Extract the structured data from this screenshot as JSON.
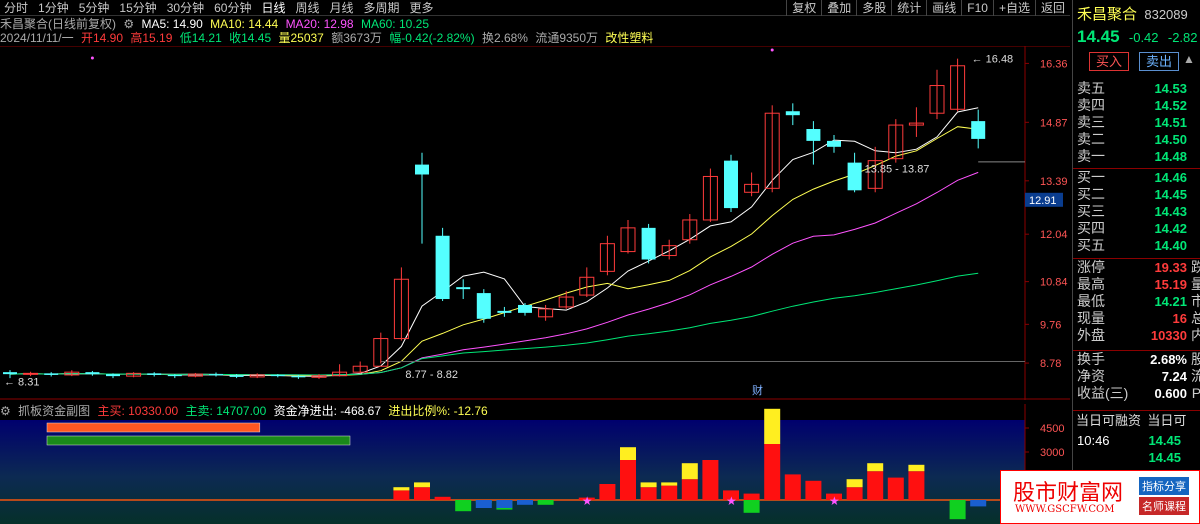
{
  "toolbar": {
    "periods": [
      "分时",
      "1分钟",
      "5分钟",
      "15分钟",
      "30分钟",
      "60分钟",
      "日线",
      "周线",
      "月线",
      "多周期",
      "更多"
    ],
    "active_period": "日线",
    "actions": [
      "复权",
      "叠加",
      "多股",
      "统计",
      "画线",
      "F10",
      "+自选",
      "返回"
    ]
  },
  "info1": {
    "title": "禾昌聚合(日线前复权)",
    "ma5": "MA5: 14.90",
    "ma10": "MA10: 14.44",
    "ma20": "MA20: 12.98",
    "ma60": "MA60: 10.25"
  },
  "info2": {
    "date": "2024/11/11/一",
    "open": "开14.90",
    "high": "高15.19",
    "low": "低14.21",
    "close": "收14.45",
    "vol": "量25037",
    "amount": "额3673万",
    "change": "幅-0.42(-2.82%)",
    "turnover": "换2.68%",
    "float": "流通9350万",
    "concept": "改性塑料"
  },
  "price_axis": [
    "16.36",
    "14.87",
    "13.39",
    "12.04",
    "10.84",
    "9.76",
    "8.78"
  ],
  "price_tag": "12.91",
  "annotations": {
    "high_label": "16.48",
    "range_label": "13.85 - 13.87",
    "low_label": "8.31",
    "low_range": "8.77 - 8.82",
    "cai": "财"
  },
  "sub_header": {
    "title": "抓板资金副图",
    "main_buy": "主买: 10330.00",
    "main_sell": "主卖: 14707.00",
    "net": "资金净进出: -468.67",
    "ratio": "进出比例%: -12.76"
  },
  "sub_axis": [
    "4500",
    "3000",
    "1500"
  ],
  "right_panel": {
    "name": "禾昌聚合",
    "code": "832089",
    "price": "14.45",
    "change": "-0.42",
    "pct": "-2.82",
    "buy_btn": "买入",
    "sell_btn": "卖出",
    "asks": [
      {
        "label": "卖五",
        "price": "14.53"
      },
      {
        "label": "卖四",
        "price": "14.52"
      },
      {
        "label": "卖三",
        "price": "14.51"
      },
      {
        "label": "卖二",
        "price": "14.50"
      },
      {
        "label": "卖一",
        "price": "14.48"
      }
    ],
    "bids": [
      {
        "label": "买一",
        "price": "14.46"
      },
      {
        "label": "买二",
        "price": "14.45"
      },
      {
        "label": "买三",
        "price": "14.43"
      },
      {
        "label": "买四",
        "price": "14.42"
      },
      {
        "label": "买五",
        "price": "14.40"
      }
    ],
    "stats": [
      {
        "label": "涨停",
        "value": "19.33",
        "extra": "跌"
      },
      {
        "label": "最高",
        "value": "15.19",
        "extra": "量"
      },
      {
        "label": "最低",
        "value": "14.21",
        "extra": "市"
      },
      {
        "label": "现量",
        "value": "16",
        "extra": "总"
      },
      {
        "label": "外盘",
        "value": "10330",
        "extra": "内"
      }
    ],
    "stats2": [
      {
        "label": "换手",
        "value": "2.68%",
        "extra": "股"
      },
      {
        "label": "净资",
        "value": "7.24",
        "extra": "流"
      },
      {
        "label": "收益(三)",
        "value": "0.600",
        "extra": "PI"
      }
    ],
    "margin_label": "当日可融资",
    "margin_label2": "当日可",
    "ticks": [
      {
        "time": "10:46",
        "price": "14.45"
      },
      {
        "time": "",
        "price": "14.45"
      }
    ]
  },
  "watermark": {
    "title": "股市财富网",
    "url": "WWW.GSCFW.COM",
    "tag1": "指标分享",
    "tag2": "名师课程"
  },
  "colors": {
    "up": "#ff3b3b",
    "down": "#54ffff",
    "ma5": "#ffffff",
    "ma10": "#ffff54",
    "ma20": "#ff54ff",
    "ma60": "#00e676"
  },
  "chart_data": {
    "type": "candlestick",
    "note_ma": "MA5 white, MA10 yellow, MA20 magenta, MA60 green",
    "candles": [
      {
        "o": 8.55,
        "c": 8.5,
        "h": 8.6,
        "l": 8.4
      },
      {
        "o": 8.5,
        "c": 8.52,
        "h": 8.56,
        "l": 8.45
      },
      {
        "o": 8.52,
        "c": 8.48,
        "h": 8.55,
        "l": 8.44
      },
      {
        "o": 8.48,
        "c": 8.55,
        "h": 8.6,
        "l": 8.45
      },
      {
        "o": 8.55,
        "c": 8.5,
        "h": 8.58,
        "l": 8.46
      },
      {
        "o": 8.5,
        "c": 8.45,
        "h": 8.52,
        "l": 8.4
      },
      {
        "o": 8.45,
        "c": 8.52,
        "h": 8.55,
        "l": 8.42
      },
      {
        "o": 8.52,
        "c": 8.48,
        "h": 8.55,
        "l": 8.44
      },
      {
        "o": 8.48,
        "c": 8.45,
        "h": 8.5,
        "l": 8.4
      },
      {
        "o": 8.45,
        "c": 8.5,
        "h": 8.53,
        "l": 8.42
      },
      {
        "o": 8.5,
        "c": 8.47,
        "h": 8.54,
        "l": 8.44
      },
      {
        "o": 8.47,
        "c": 8.43,
        "h": 8.5,
        "l": 8.4
      },
      {
        "o": 8.43,
        "c": 8.48,
        "h": 8.52,
        "l": 8.4
      },
      {
        "o": 8.48,
        "c": 8.45,
        "h": 8.5,
        "l": 8.42
      },
      {
        "o": 8.45,
        "c": 8.42,
        "h": 8.48,
        "l": 8.38
      },
      {
        "o": 8.42,
        "c": 8.46,
        "h": 8.5,
        "l": 8.38
      },
      {
        "o": 8.46,
        "c": 8.55,
        "h": 8.75,
        "l": 8.44
      },
      {
        "o": 8.55,
        "c": 8.7,
        "h": 8.82,
        "l": 8.52
      },
      {
        "o": 8.7,
        "c": 9.4,
        "h": 9.55,
        "l": 8.77
      },
      {
        "o": 9.4,
        "c": 10.9,
        "h": 11.2,
        "l": 9.35
      },
      {
        "o": 13.8,
        "c": 13.55,
        "h": 14.1,
        "l": 11.8
      },
      {
        "o": 12.0,
        "c": 10.4,
        "h": 12.2,
        "l": 10.35
      },
      {
        "o": 10.7,
        "c": 10.65,
        "h": 10.9,
        "l": 10.4
      },
      {
        "o": 10.55,
        "c": 9.9,
        "h": 10.65,
        "l": 9.8
      },
      {
        "o": 10.1,
        "c": 10.05,
        "h": 10.2,
        "l": 9.95
      },
      {
        "o": 10.25,
        "c": 10.05,
        "h": 10.3,
        "l": 9.98
      },
      {
        "o": 9.95,
        "c": 10.15,
        "h": 10.25,
        "l": 9.85
      },
      {
        "o": 10.2,
        "c": 10.45,
        "h": 10.6,
        "l": 10.15
      },
      {
        "o": 10.5,
        "c": 10.95,
        "h": 11.2,
        "l": 10.45
      },
      {
        "o": 11.1,
        "c": 11.8,
        "h": 12.0,
        "l": 11.0
      },
      {
        "o": 11.6,
        "c": 12.2,
        "h": 12.4,
        "l": 11.55
      },
      {
        "o": 12.2,
        "c": 11.4,
        "h": 12.3,
        "l": 11.3
      },
      {
        "o": 11.5,
        "c": 11.75,
        "h": 11.9,
        "l": 11.4
      },
      {
        "o": 11.9,
        "c": 12.4,
        "h": 12.55,
        "l": 11.8
      },
      {
        "o": 12.4,
        "c": 13.5,
        "h": 13.7,
        "l": 12.35
      },
      {
        "o": 13.9,
        "c": 12.7,
        "h": 14.05,
        "l": 12.6
      },
      {
        "o": 13.1,
        "c": 13.3,
        "h": 13.6,
        "l": 13.0
      },
      {
        "o": 13.2,
        "c": 15.1,
        "h": 15.3,
        "l": 13.1
      },
      {
        "o": 15.15,
        "c": 15.05,
        "h": 15.35,
        "l": 14.8
      },
      {
        "o": 14.7,
        "c": 14.4,
        "h": 14.9,
        "l": 13.8
      },
      {
        "o": 14.4,
        "c": 14.25,
        "h": 14.55,
        "l": 14.1
      },
      {
        "o": 13.85,
        "c": 13.15,
        "h": 14.1,
        "l": 13.1
      },
      {
        "o": 13.2,
        "c": 13.9,
        "h": 14.25,
        "l": 13.1
      },
      {
        "o": 13.95,
        "c": 14.8,
        "h": 14.95,
        "l": 13.85
      },
      {
        "o": 14.8,
        "c": 14.85,
        "h": 15.25,
        "l": 14.5
      },
      {
        "o": 15.1,
        "c": 15.8,
        "h": 16.2,
        "l": 14.95
      },
      {
        "o": 15.2,
        "c": 16.3,
        "h": 16.48,
        "l": 15.15
      },
      {
        "o": 14.9,
        "c": 14.45,
        "h": 15.19,
        "l": 14.21
      }
    ],
    "sub_red": [
      0,
      0,
      0,
      0,
      0,
      0,
      0,
      0,
      0,
      0,
      0,
      0,
      0,
      0,
      0,
      0,
      0,
      0,
      0,
      600,
      800,
      200,
      0,
      0,
      0,
      0,
      0,
      0,
      150,
      1000,
      2500,
      800,
      900,
      1300,
      2500,
      600,
      400,
      3500,
      1600,
      1200,
      400,
      800,
      1800,
      1400,
      1800,
      0,
      0,
      0
    ],
    "sub_yellow": [
      0,
      0,
      0,
      0,
      0,
      0,
      0,
      0,
      0,
      0,
      0,
      0,
      0,
      0,
      0,
      0,
      0,
      0,
      0,
      200,
      300,
      0,
      0,
      0,
      0,
      0,
      0,
      0,
      0,
      0,
      800,
      300,
      200,
      1000,
      0,
      0,
      0,
      2200,
      0,
      0,
      0,
      500,
      500,
      0,
      400,
      0,
      0,
      0
    ],
    "sub_green": [
      0,
      0,
      0,
      0,
      0,
      0,
      0,
      0,
      0,
      0,
      0,
      0,
      0,
      0,
      0,
      0,
      0,
      0,
      0,
      0,
      0,
      0,
      700,
      200,
      600,
      100,
      300,
      0,
      0,
      0,
      0,
      0,
      0,
      0,
      0,
      0,
      800,
      0,
      0,
      0,
      0,
      0,
      0,
      0,
      0,
      0,
      1200,
      0
    ],
    "sub_blue": [
      0,
      0,
      0,
      0,
      0,
      0,
      0,
      0,
      0,
      0,
      0,
      0,
      0,
      0,
      0,
      0,
      0,
      0,
      0,
      0,
      0,
      0,
      0,
      500,
      500,
      300,
      0,
      0,
      0,
      0,
      0,
      0,
      0,
      0,
      0,
      0,
      0,
      0,
      0,
      0,
      0,
      0,
      0,
      0,
      0,
      0,
      0,
      400
    ],
    "volume_bars": [
      {
        "label": "主买",
        "value": 10330.0,
        "color": "#ff5722"
      },
      {
        "label": "主卖",
        "value": 14707.0,
        "color": "#1a8a1a"
      }
    ],
    "ylim": [
      8.2,
      16.8
    ],
    "sub_ylim": [
      -1500,
      5000
    ]
  }
}
